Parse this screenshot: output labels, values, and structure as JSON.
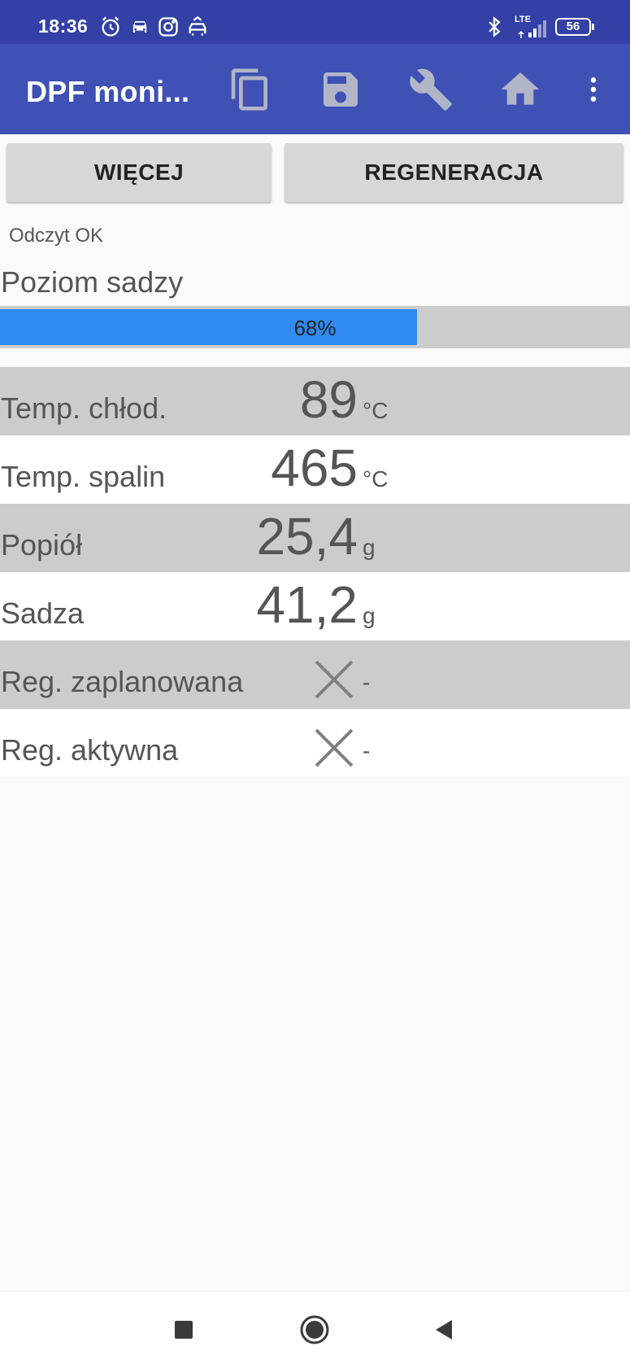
{
  "status_bar": {
    "time": "18:36",
    "left_icons": [
      "alarm-icon",
      "car-icon",
      "instagram-icon",
      "car-front-icon"
    ],
    "right_icons": [
      "bluetooth-icon",
      "lte-signal-icon"
    ],
    "network": "LTE",
    "battery": "56"
  },
  "app_bar": {
    "title": "DPF moni...",
    "actions": [
      "copy-icon",
      "save-icon",
      "wrench-icon",
      "home-icon",
      "more-vert-icon"
    ]
  },
  "buttons": {
    "more": "WIĘCEJ",
    "regen": "REGENERACJA"
  },
  "status_text": "Odczyt OK",
  "soot_level": {
    "label": "Poziom sadzy",
    "percent": 68,
    "percent_text": "68%"
  },
  "rows": [
    {
      "label": "Temp. chłod.",
      "value": "89",
      "unit": "°C"
    },
    {
      "label": "Temp. spalin",
      "value": "465",
      "unit": "°C"
    },
    {
      "label": "Popiół",
      "value": "25,4",
      "unit": "g"
    },
    {
      "label": "Sadza",
      "value": "41,2",
      "unit": "g"
    },
    {
      "label": "Reg. zaplanowana",
      "icon": "x-icon",
      "value": "-"
    },
    {
      "label": "Reg. aktywna",
      "icon": "x-icon",
      "value": "-"
    }
  ],
  "colors": {
    "status_bar": "#3340a6",
    "app_bar": "#3f51b5",
    "progress_fill": "#2f8bf1",
    "row_shade": "#cccccc"
  },
  "nav_bar": [
    "recents-icon",
    "home-circle-icon",
    "back-icon"
  ]
}
